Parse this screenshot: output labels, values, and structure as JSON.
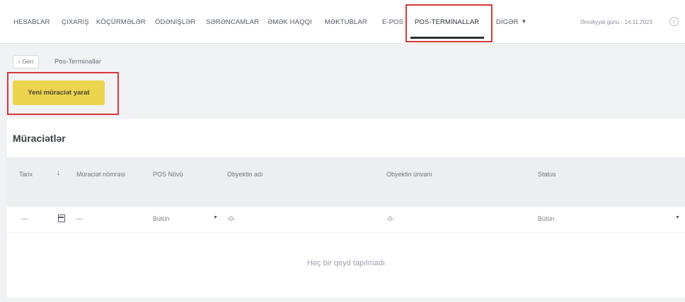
{
  "nav": {
    "items": [
      {
        "label": "HESABLAR"
      },
      {
        "label": "ÇIXARIŞ"
      },
      {
        "label": "KÖÇÜRMƏLƏR"
      },
      {
        "label": "ÖDƏNİŞLƏR"
      },
      {
        "label": "SƏRƏNCAMLAR"
      },
      {
        "label": "ƏMƏK HAQQI"
      },
      {
        "label": "MƏKTUBLAR"
      },
      {
        "label": "E-POS"
      },
      {
        "label": "POS-TERMİNALLAR",
        "active": true
      },
      {
        "label": "DİGƏR"
      }
    ],
    "more_caret": "▼",
    "operation_day": "Əməliyyat günü - 14.11.2023",
    "info_icon": "i"
  },
  "breadcrumb": {
    "back_label": "‹ Geri",
    "current": "Pos-Terminallar"
  },
  "actions": {
    "new_application_label": "Yeni müraciət yarat"
  },
  "applications": {
    "title": "Müraciətlər",
    "columns": [
      {
        "label": "Tarix"
      },
      {
        "label": "↓"
      },
      {
        "label": "Müraciət nömrəsi"
      },
      {
        "label": "POS Növü"
      },
      {
        "label": "Obyektin adı"
      },
      {
        "label": "Obyektin ünvanı"
      },
      {
        "label": "Status"
      }
    ],
    "filters": {
      "date": "—",
      "number": "—",
      "pos_type": "Bütün",
      "object_name": "-0-",
      "object_address": "-0-",
      "status": "Bütün"
    },
    "empty_message": "Heç bir qeyd tapılmadı"
  },
  "colors": {
    "accent_yellow": "#ecd44f",
    "highlight_red": "#d9373c",
    "header_bg": "#eceef1"
  }
}
